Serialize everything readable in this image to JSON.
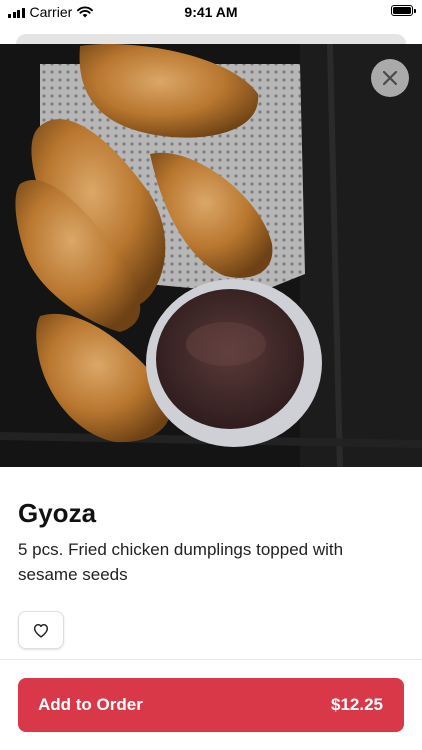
{
  "status_bar": {
    "carrier": "Carrier",
    "time": "9:41 AM",
    "icons": [
      "signal-icon",
      "wifi-icon",
      "battery-icon"
    ]
  },
  "hero": {
    "image_subject": "fried gyoza dumplings with dipping sauce in a black container"
  },
  "close_button": {
    "icon": "close-icon"
  },
  "item": {
    "title": "Gyoza",
    "description": "5 pcs. Fried chicken dumplings topped with sesame seeds"
  },
  "favorite_button": {
    "icon": "heart-icon"
  },
  "order_button": {
    "label": "Add to Order",
    "price": "$12.25"
  },
  "colors": {
    "accent": "#d93848",
    "text": "#111111",
    "close_bg": "#bebebe"
  }
}
